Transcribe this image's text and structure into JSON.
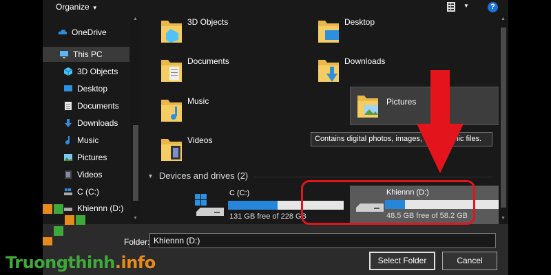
{
  "toolbar": {
    "organize_label": "Organize",
    "view_icon": "view-options-icon",
    "help_label": "?"
  },
  "nav": {
    "items": [
      {
        "label": "OneDrive",
        "icon": "cloud-icon"
      },
      {
        "label": "This PC",
        "icon": "computer-icon"
      },
      {
        "label": "3D Objects",
        "icon": "cube-icon"
      },
      {
        "label": "Desktop",
        "icon": "desktop-icon"
      },
      {
        "label": "Documents",
        "icon": "document-icon"
      },
      {
        "label": "Downloads",
        "icon": "download-arrow-icon"
      },
      {
        "label": "Music",
        "icon": "music-note-icon"
      },
      {
        "label": "Pictures",
        "icon": "picture-icon"
      },
      {
        "label": "Videos",
        "icon": "film-icon"
      },
      {
        "label": "C (C:)",
        "icon": "windows-drive-icon"
      },
      {
        "label": "Khiennn (D:)",
        "icon": "drive-icon"
      }
    ],
    "selected": "This PC"
  },
  "folders": [
    {
      "label": "3D Objects"
    },
    {
      "label": "Desktop"
    },
    {
      "label": "Documents"
    },
    {
      "label": "Downloads"
    },
    {
      "label": "Music"
    },
    {
      "label": "Pictures"
    },
    {
      "label": "Videos"
    }
  ],
  "tooltip": "Contains digital photos, images, and graphic files.",
  "devices_section": {
    "title": "Devices and drives (2)"
  },
  "drives": [
    {
      "name": "C (C:)",
      "free_text": "131 GB free of 228 GB",
      "used_fraction": 0.43
    },
    {
      "name": "Khiennn (D:)",
      "free_text": "48.5 GB free of 58.2 GB",
      "used_fraction": 0.17
    }
  ],
  "bottom": {
    "folder_label": "Folder:",
    "folder_value": "Khiennn (D:)",
    "select_label": "Select Folder",
    "cancel_label": "Cancel"
  },
  "watermark": {
    "part1": "Truongthinh",
    "part2": ".info"
  },
  "colors": {
    "accent": "#2686d9",
    "highlight": "#e3141b",
    "folder": "#f2c55c"
  }
}
